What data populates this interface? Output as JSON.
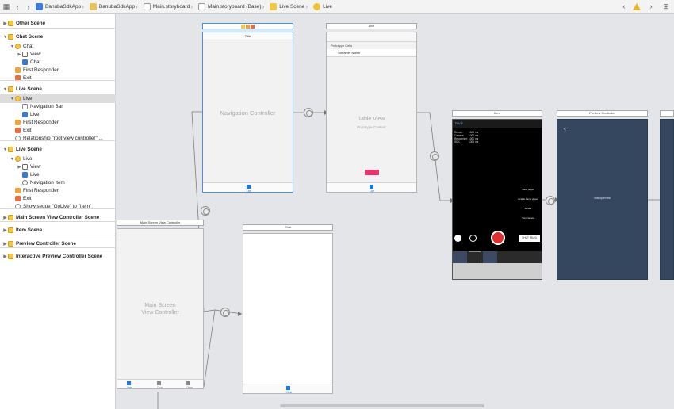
{
  "breadcrumbs": [
    "BanubaSdkApp",
    "BanubaSdkApp",
    "Main.storyboard",
    "Main.storyboard (Base)",
    "Live Scene",
    "Live"
  ],
  "outline": [
    {
      "label": "Other Scene",
      "depth": 0,
      "disclosure": "▶",
      "icon": "scene",
      "bold": true
    },
    {
      "label": "Chat Scene",
      "depth": 0,
      "disclosure": "▼",
      "icon": "scene",
      "bold": true
    },
    {
      "label": "Chat",
      "depth": 1,
      "disclosure": "▼",
      "icon": "vc"
    },
    {
      "label": "View",
      "depth": 2,
      "disclosure": "▶",
      "icon": "view"
    },
    {
      "label": "Chat",
      "depth": 2,
      "disclosure": "",
      "icon": "star"
    },
    {
      "label": "First Responder",
      "depth": 1,
      "disclosure": "",
      "icon": "resp"
    },
    {
      "label": "Exit",
      "depth": 1,
      "disclosure": "",
      "icon": "exit"
    },
    {
      "label": "Live Scene",
      "depth": 0,
      "disclosure": "▼",
      "icon": "scene",
      "bold": true
    },
    {
      "label": "Live",
      "depth": 1,
      "disclosure": "▼",
      "icon": "vc",
      "selected": true
    },
    {
      "label": "Navigation Bar",
      "depth": 2,
      "disclosure": "",
      "icon": "nav"
    },
    {
      "label": "Live",
      "depth": 2,
      "disclosure": "",
      "icon": "star"
    },
    {
      "label": "First Responder",
      "depth": 1,
      "disclosure": "",
      "icon": "resp"
    },
    {
      "label": "Exit",
      "depth": 1,
      "disclosure": "",
      "icon": "exit"
    },
    {
      "label": "Relationship \"root view controller\" ...",
      "depth": 1,
      "disclosure": "",
      "icon": "rel"
    },
    {
      "label": "Live Scene",
      "depth": 0,
      "disclosure": "▼",
      "icon": "scene",
      "bold": true
    },
    {
      "label": "Live",
      "depth": 1,
      "disclosure": "▼",
      "icon": "vc"
    },
    {
      "label": "View",
      "depth": 2,
      "disclosure": "▶",
      "icon": "view"
    },
    {
      "label": "Live",
      "depth": 2,
      "disclosure": "",
      "icon": "star"
    },
    {
      "label": "Navigation Item",
      "depth": 2,
      "disclosure": "",
      "icon": "item"
    },
    {
      "label": "First Responder",
      "depth": 1,
      "disclosure": "",
      "icon": "resp"
    },
    {
      "label": "Exit",
      "depth": 1,
      "disclosure": "",
      "icon": "exit"
    },
    {
      "label": "Show segue \"GoLive\" to \"Item\"",
      "depth": 1,
      "disclosure": "",
      "icon": "rel"
    },
    {
      "label": "Main Screen View Controller Scene",
      "depth": 0,
      "disclosure": "▶",
      "icon": "scene",
      "bold": true
    },
    {
      "label": "Item Scene",
      "depth": 0,
      "disclosure": "▶",
      "icon": "scene",
      "bold": true
    },
    {
      "label": "Preview Controller Scene",
      "depth": 0,
      "disclosure": "▶",
      "icon": "scene",
      "bold": true
    },
    {
      "label": "Interactive Preview Controller Scene",
      "depth": 0,
      "disclosure": "▶",
      "icon": "scene",
      "bold": true
    }
  ],
  "canvas": {
    "nav_controller": {
      "title": "Title",
      "label": "Navigation Controller",
      "tab_label": "Live"
    },
    "table_view": {
      "title": "Live",
      "prototype_cells": "Prototype Cells",
      "cell_label": "Streamer Name",
      "label": "Table View",
      "sublabel": "Prototype Content",
      "tab_label": "Live"
    },
    "item": {
      "title": "Item",
      "back": "Back",
      "stats": [
        "Render:",
        "Camera:",
        "Recognizer:",
        "SDK:"
      ],
      "stat_values": [
        "1000 ms",
        "1000 ms",
        "1000 ms",
        "1000 ms"
      ],
      "effects": [
        "Mask player",
        "Enable frame player",
        "Bundle",
        "Turn camera"
      ],
      "start_label": "START",
      "start_value": "SHUT (RUN)"
    },
    "preview": {
      "title": "Preview Controller",
      "label": "Videopreview"
    },
    "main_screen": {
      "title": "Main Screen View Controller",
      "label_line1": "Main Screen",
      "label_line2": "View Controller",
      "tabs": [
        "Live",
        "Chat",
        "Other"
      ]
    },
    "chat": {
      "title": "Chat",
      "tab_label": "Chat"
    }
  }
}
